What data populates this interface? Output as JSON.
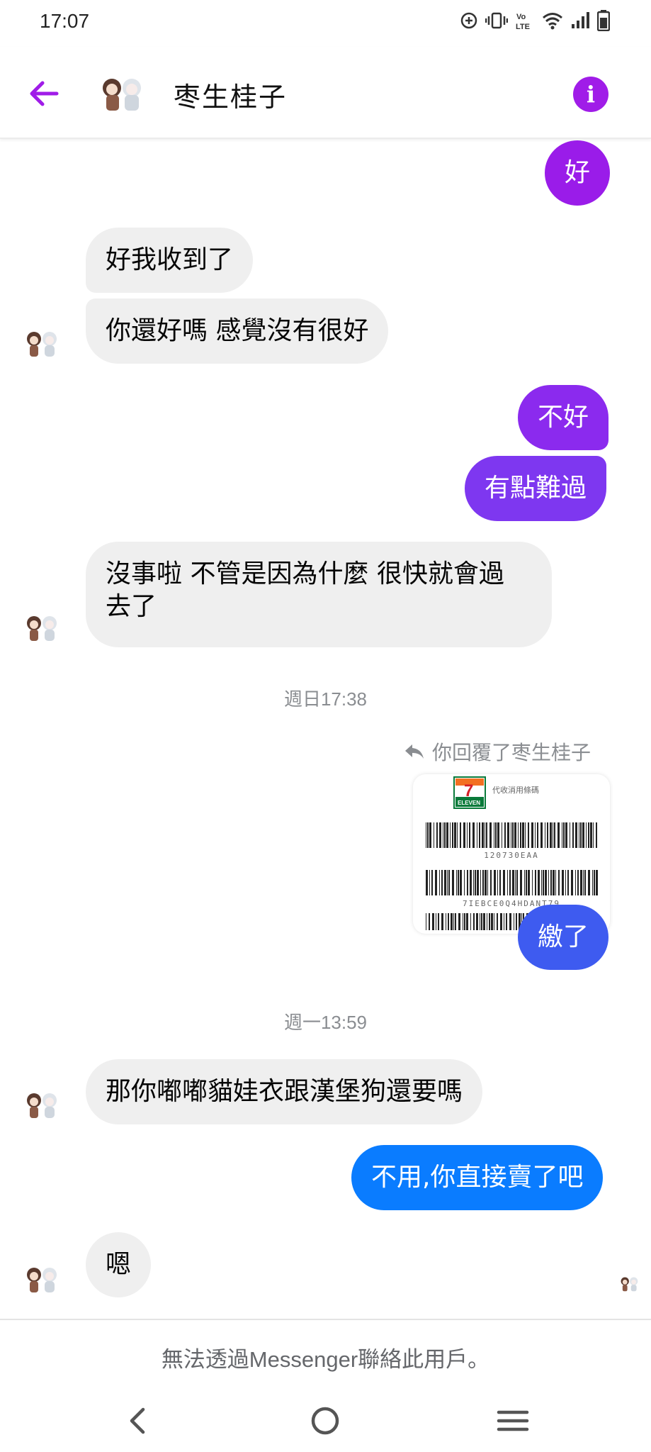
{
  "status_bar": {
    "time": "17:07"
  },
  "header": {
    "contact_name": "枣生桂子",
    "back_icon": "back-arrow-icon",
    "info_icon": "info-icon"
  },
  "colors": {
    "accent": "#a01ce8",
    "out_purple": "#9a1ce9",
    "out_violet": "#7e37f0",
    "out_blue": "#3e5bf0",
    "out_azure": "#0a7cff",
    "incoming": "#efefef"
  },
  "messages": [
    {
      "from": "me",
      "text": "好"
    },
    {
      "from": "them",
      "text": "好我收到了"
    },
    {
      "from": "them",
      "text": "你還好嗎 感覺沒有很好"
    },
    {
      "from": "me",
      "text": "不好"
    },
    {
      "from": "me",
      "text": "有點難過"
    },
    {
      "from": "them",
      "line1": "沒事啦 不管是因為什麼 很快就會過",
      "line2": "去了"
    },
    {
      "from": "me",
      "text": "繳了"
    },
    {
      "from": "them",
      "text": "那你嘟嘟貓娃衣跟漢堡狗還要嗎"
    },
    {
      "from": "me",
      "text": "不用,你直接賣了吧"
    },
    {
      "from": "them",
      "text": "嗯"
    }
  ],
  "timestamps": [
    "週日17:38",
    "週一13:59"
  ],
  "reply_note": "你回覆了枣生桂子",
  "receipt": {
    "store_label": "代收消用條碼",
    "logo_number": "7",
    "logo_text": "ELEVEN",
    "barcode1_text": "120730EAA",
    "barcode2_text": "7IEBCE0Q4HDANT79"
  },
  "footer": {
    "note": "無法透過Messenger聯絡此用戶。"
  }
}
